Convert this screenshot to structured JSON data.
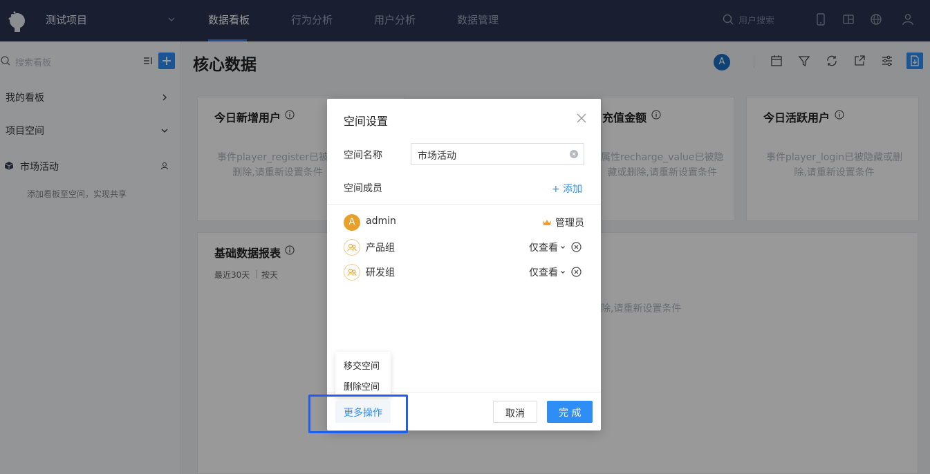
{
  "topbar": {
    "project_name": "测试项目",
    "nav": [
      "数据看板",
      "行为分析",
      "用户分析",
      "数据管理"
    ],
    "search_placeholder": "用户搜索"
  },
  "sidebar": {
    "search_placeholder": "搜索看板",
    "my_boards": "我的看板",
    "project_space": "项目空间",
    "space_name": "市场活动",
    "space_hint": "添加看板至空间，实现共享"
  },
  "main": {
    "title": "核心数据",
    "avatar_letter": "A",
    "cards": [
      {
        "title": "今日新增用户",
        "msg_line1": "事件player_register已被隐",
        "msg_line2": "删除,请重新设置条件"
      },
      {
        "title": "充值金额",
        "msg_line1": "属性recharge_value已被隐",
        "msg_line2": "藏或删除,请重新设置条件"
      },
      {
        "title": "今日活跃用户",
        "msg_line1": "事件player_login已被隐藏或删",
        "msg_line2": "除,请重新设置条件"
      },
      {
        "title": "基础数据报表",
        "sub_range": "最近30天",
        "sub_sep": "|",
        "sub_unit": "按天",
        "msg": "除,请重新设置条件"
      }
    ]
  },
  "modal": {
    "title": "空间设置",
    "name_label": "空间名称",
    "name_value": "市场活动",
    "members_label": "空间成员",
    "add_label": "+ 添加",
    "members": [
      {
        "name": "admin",
        "role": "管理员",
        "avatar": "A"
      },
      {
        "name": "产品组",
        "perm": "仅查看"
      },
      {
        "name": "研发组",
        "perm": "仅查看"
      }
    ],
    "more_menu": [
      "移交空间",
      "删除空间"
    ],
    "more_label": "更多操作",
    "cancel_label": "取消",
    "ok_label": "完 成"
  },
  "colors": {
    "nav_bg": "#2a3350",
    "primary": "#2e8ef5",
    "highlight": "#1f5ef0",
    "admin_avatar": "#e7a12a"
  }
}
